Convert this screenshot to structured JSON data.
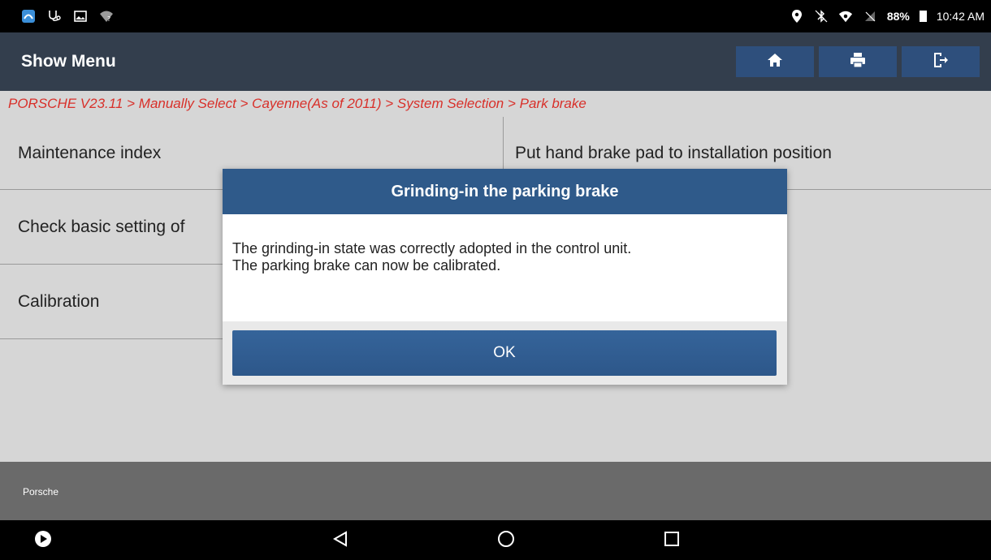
{
  "status_bar": {
    "battery": "88%",
    "time": "10:42 AM",
    "left_icons": [
      "app-icon",
      "stethoscope-icon",
      "image-icon",
      "wifi-question-icon"
    ],
    "right_icons": [
      "location-icon",
      "bluetooth-icon",
      "wifi-icon",
      "no-signal-icon"
    ]
  },
  "header": {
    "title": "Show Menu",
    "actions": [
      "home-icon",
      "print-icon",
      "exit-icon"
    ]
  },
  "breadcrumb": "PORSCHE V23.11 > Manually Select > Cayenne(As of 2011) > System Selection > Park brake",
  "menu": {
    "items": [
      "Maintenance index",
      "Put hand brake pad to installation position",
      "Check basic setting of",
      "Calibration"
    ]
  },
  "footer": {
    "label": "Porsche"
  },
  "dialog": {
    "title": "Grinding-in the parking brake",
    "message_line1": "The grinding-in state was correctly adopted in the control unit.",
    "message_line2": "The parking brake can now be calibrated.",
    "ok_label": "OK"
  },
  "colors": {
    "header_bg": "#333e4d",
    "header_button_bg": "#2e4f7c",
    "breadcrumb_text": "#d8302a",
    "dialog_title_bg": "#2f5a8a",
    "ok_button_bg": "#35649a",
    "footer_bg": "#6a6a6a"
  }
}
